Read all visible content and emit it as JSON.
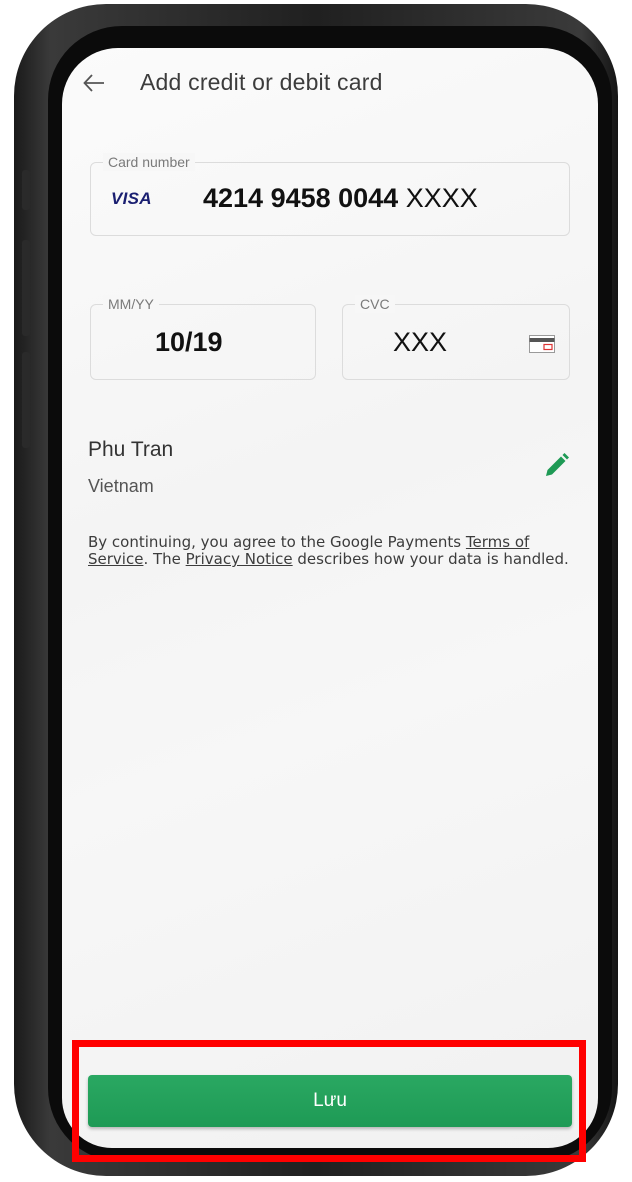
{
  "header": {
    "title": "Add credit or debit card",
    "back_icon": "arrow-left-icon"
  },
  "card_number": {
    "label": "Card number",
    "brand": "VISA",
    "digits_bold": "4214 9458 0044",
    "digits_masked": "XXXX"
  },
  "expiry": {
    "label": "MM/YY",
    "value": "10/19"
  },
  "cvc": {
    "label": "CVC",
    "value": "XXX",
    "icon": "card-back-icon"
  },
  "billing": {
    "name": "Phu Tran",
    "country": "Vietnam",
    "edit_icon": "pencil-icon"
  },
  "legal": {
    "prefix": "By continuing, you agree to the Google Payments ",
    "terms_link": "Terms of Service",
    "middle": ". The ",
    "privacy_link": "Privacy Notice",
    "suffix": " describes how your data is handled."
  },
  "save_button": {
    "label": "Lưu"
  },
  "colors": {
    "accent_green": "#1e9a55",
    "visa_blue": "#1a1f71",
    "highlight_red": "#ff0000"
  }
}
